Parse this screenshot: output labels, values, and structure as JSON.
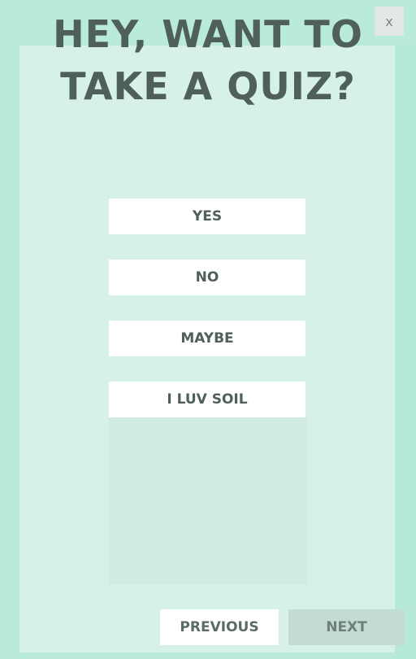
{
  "quiz": {
    "title_line1": "HEY, WANT TO",
    "title_line2": "TAKE A QUIZ?",
    "close_label": "x",
    "answers": [
      {
        "label": "YES"
      },
      {
        "label": "NO"
      },
      {
        "label": "MAYBE"
      },
      {
        "label": "I LUV SOIL"
      }
    ],
    "nav": {
      "previous_label": "PREVIOUS",
      "next_label": "NEXT"
    }
  },
  "colors": {
    "overlay_bg": "#b9ebd8",
    "panel_bg": "#d6f1e8",
    "title_text": "#4f5f5b",
    "button_bg": "#ffffff",
    "next_button_bg": "#c2dcd4",
    "close_button_bg": "#e3e8e6"
  }
}
